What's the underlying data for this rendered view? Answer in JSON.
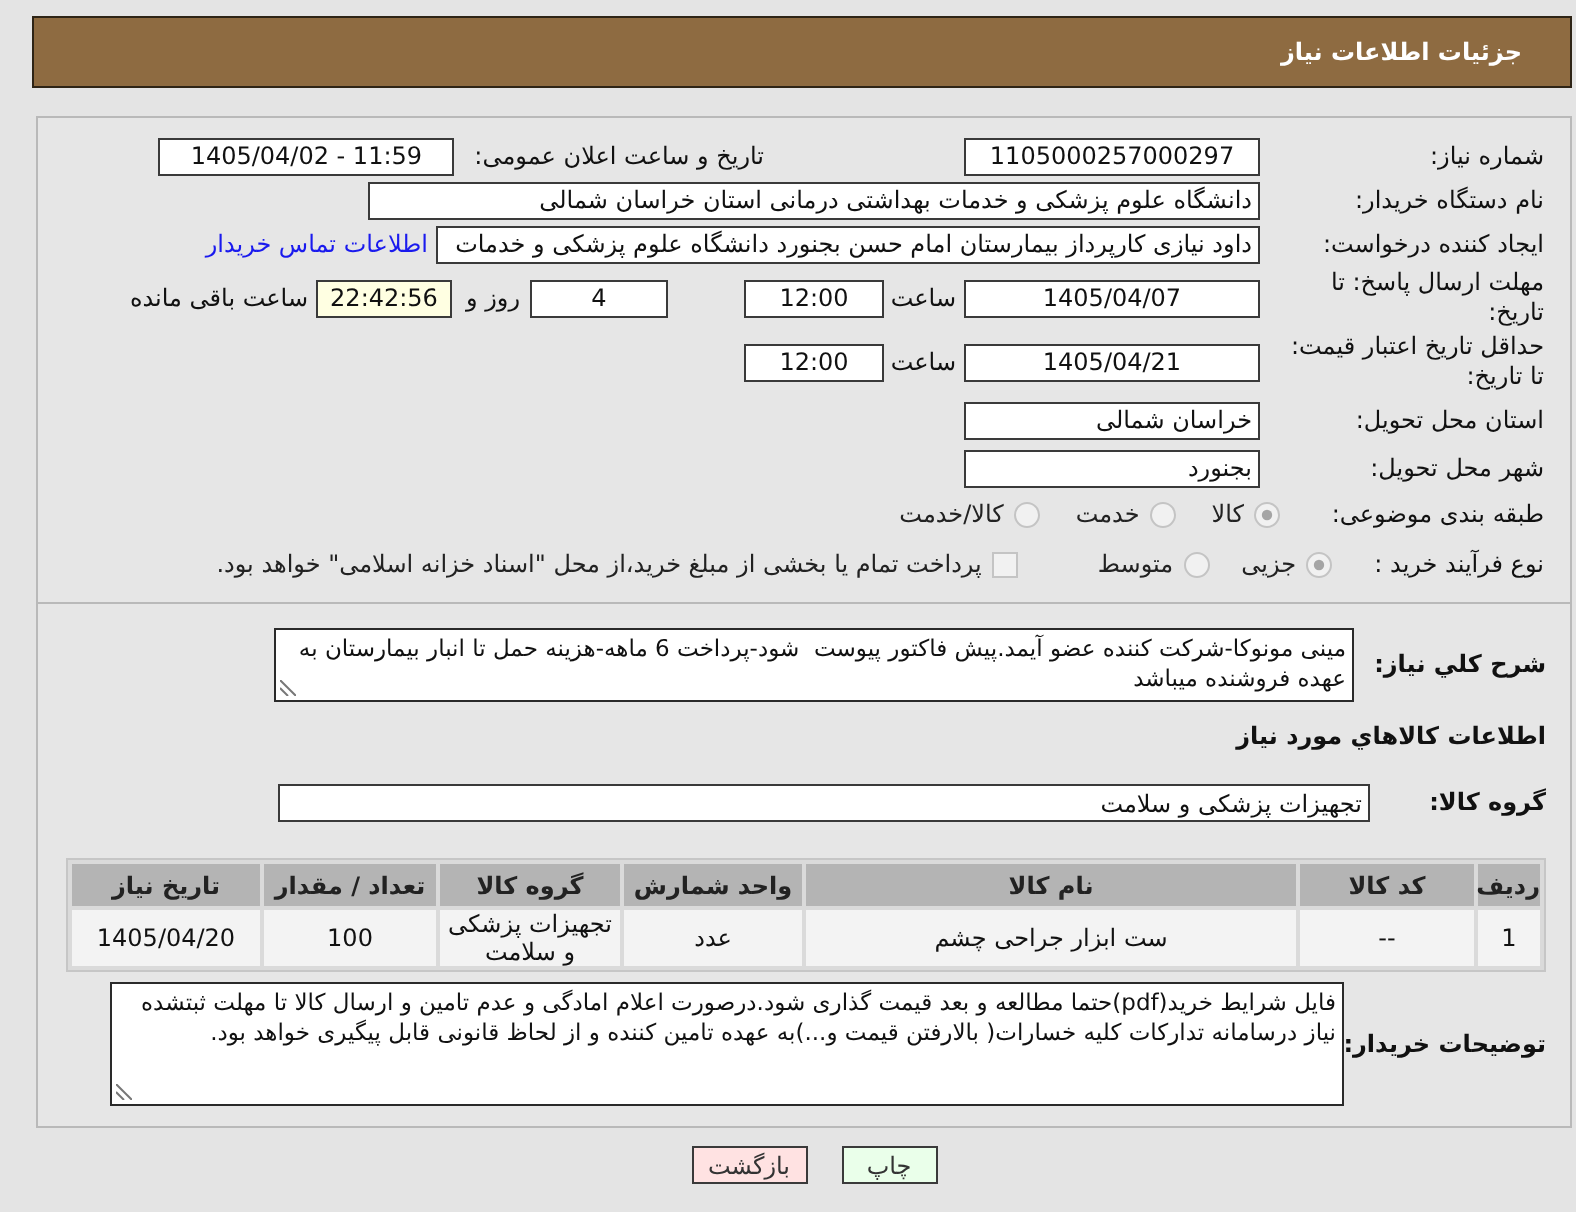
{
  "header": {
    "title": "جزئیات اطلاعات نیاز"
  },
  "details": {
    "need_number": {
      "label": "شماره نیاز:",
      "value": "1105000257000297"
    },
    "announce_datetime": {
      "label": "تاریخ و ساعت اعلان عمومی:",
      "value": "1405/04/02 - 11:59"
    },
    "buyer_org": {
      "label": "نام دستگاه خریدار:",
      "value": "دانشگاه علوم پزشکی و خدمات بهداشتی درمانی استان خراسان شمالی"
    },
    "requester": {
      "label": "ایجاد کننده درخواست:",
      "value": "داود نیازی کارپرداز بیمارستان امام حسن بجنورد دانشگاه علوم پزشکی و خدمات",
      "contact_link": "اطلاعات تماس خریدار"
    },
    "reply_deadline": {
      "label": "مهلت ارسال پاسخ: تا تاریخ:",
      "date": "1405/04/07",
      "time_label": "ساعت",
      "time": "12:00",
      "days": "4",
      "days_label": "روز و",
      "remaining": "22:42:56",
      "remaining_label": "ساعت باقی مانده"
    },
    "price_validity": {
      "label": "حداقل تاریخ اعتبار قیمت: تا تاریخ:",
      "date": "1405/04/21",
      "time_label": "ساعت",
      "time": "12:00"
    },
    "delivery_province": {
      "label": "استان محل تحویل:",
      "value": "خراسان شمالی"
    },
    "delivery_city": {
      "label": "شهر محل تحویل:",
      "value": "بجنورد"
    },
    "subject_category": {
      "label": "طبقه بندی موضوعی:",
      "options": [
        {
          "label": "کالا",
          "selected": true,
          "disabled": true
        },
        {
          "label": "خدمت",
          "selected": false,
          "disabled": true
        },
        {
          "label": "کالا/خدمت",
          "selected": false,
          "disabled": true
        }
      ]
    },
    "purchase_process": {
      "label": "نوع فرآیند خرید :",
      "options": [
        {
          "label": "جزیی",
          "selected": true,
          "disabled": true
        },
        {
          "label": "متوسط",
          "selected": false,
          "disabled": true
        }
      ],
      "treasury_payment": {
        "label": "پرداخت تمام یا بخشی از مبلغ خرید،از محل \"اسناد خزانه اسلامی\" خواهد بود.",
        "checked": false,
        "disabled": true
      }
    }
  },
  "description": {
    "label": "شرح کلي نیاز:",
    "value": "مینی مونوکا-شرکت کننده عضو آیمد.پیش فاکتور پیوست  شود-پرداخت 6 ماهه-هزینه حمل تا انبار بیمارستان به عهده فروشنده میباشد"
  },
  "goods": {
    "title": "اطلاعات کالاهاي مورد نیاز",
    "group": {
      "label": "گروه کالا:",
      "value": "تجهیزات پزشکی و سلامت"
    },
    "table": {
      "columns": [
        "ردیف",
        "کد کالا",
        "نام کالا",
        "واحد شمارش",
        "گروه کالا",
        "تعداد / مقدار",
        "تاریخ نیاز"
      ],
      "rows": [
        [
          "1",
          "--",
          "ست ابزار جراحی چشم",
          "عدد",
          "تجهیزات پزشکی و سلامت",
          "100",
          "1405/04/20"
        ]
      ]
    }
  },
  "buyer_notes": {
    "label": "توضیحات خریدار:",
    "value": "فایل شرایط خرید(pdf)حتما مطالعه و بعد قیمت گذاری شود.درصورت اعلام امادگی و عدم تامین و ارسال کالا تا مهلت ثبتشده نیاز درسامانه تدارکات کلیه خسارات( بالارفتن قیمت و...)به عهده تامین کننده و از لحاظ قانونی قابل پیگیری خواهد بود."
  },
  "buttons": [
    {
      "kind": "print",
      "label": "چاپ"
    },
    {
      "kind": "back",
      "label": "بازگشت"
    }
  ]
}
